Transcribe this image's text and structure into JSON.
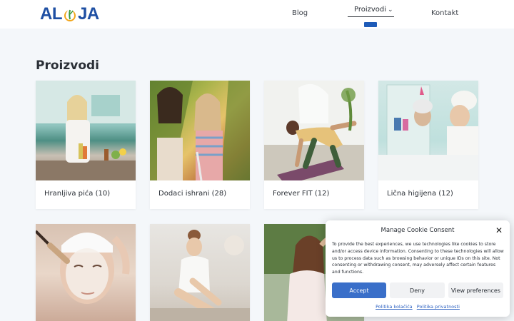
{
  "header": {
    "logo": {
      "left": "AL",
      "right": "JA"
    },
    "nav": {
      "blog": "Blog",
      "products": "Proizvodi",
      "contact": "Kontakt"
    }
  },
  "main": {
    "title": "Proizvodi",
    "categories": [
      {
        "label": "Hranljiva pića (10)"
      },
      {
        "label": "Dodaci ishrani (28)"
      },
      {
        "label": "Forever FIT (12)"
      },
      {
        "label": "Lična higijena (12)"
      }
    ]
  },
  "cookie": {
    "title": "Manage Cookie Consent",
    "text": "To provide the best experiences, we use technologies like cookies to store and/or access device information. Consenting to these technologies will allow us to process data such as browsing behavior or unique IDs on this site. Not consenting or withdrawing consent, may adversely affect certain features and functions.",
    "accept": "Accept",
    "deny": "Deny",
    "preferences": "View preferences",
    "link_cookies": "Politika kolačića",
    "link_privacy": "Politika privatnosti"
  },
  "colors": {
    "brand_blue": "#1e4fa3",
    "accent": "#3a6fc9",
    "logo_drop": "#f2a51a"
  }
}
